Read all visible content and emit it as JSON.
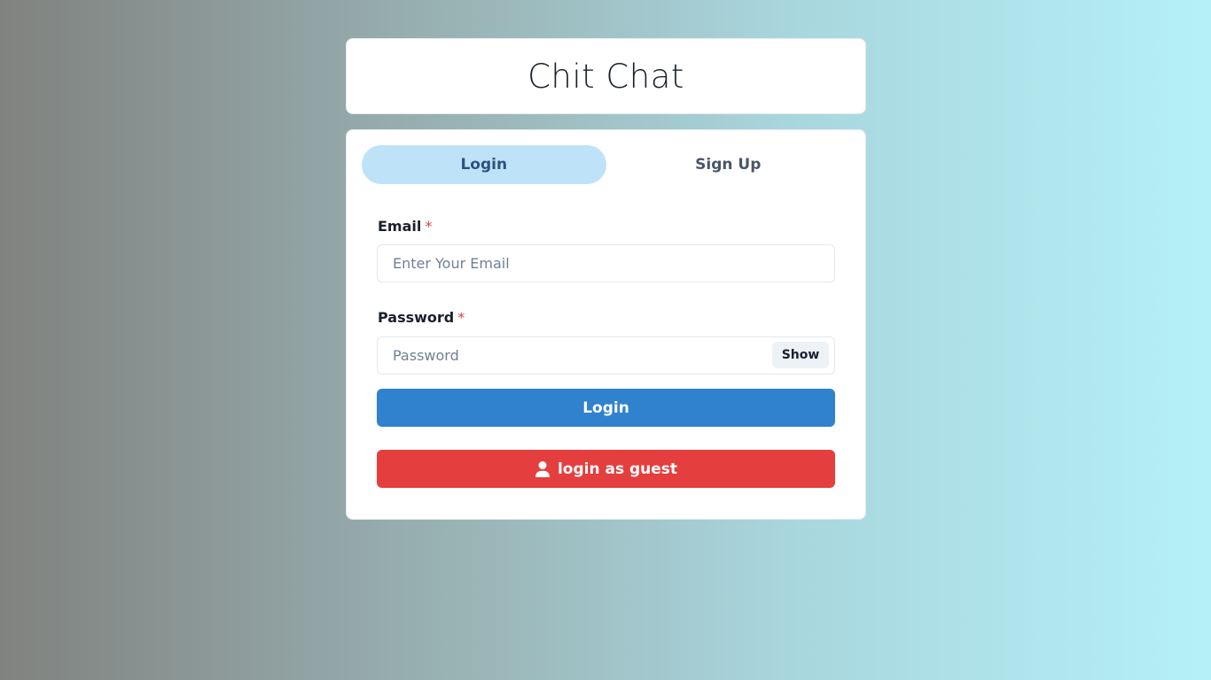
{
  "app": {
    "title": "Chit Chat"
  },
  "tabs": [
    {
      "label": "Login",
      "active": true
    },
    {
      "label": "Sign Up",
      "active": false
    }
  ],
  "form": {
    "email": {
      "label": "Email",
      "required_mark": "*",
      "value": "",
      "placeholder": "Enter Your Email"
    },
    "password": {
      "label": "Password",
      "required_mark": "*",
      "value": "",
      "placeholder": "Password",
      "toggle_label": "Show"
    },
    "submit_label": "Login",
    "guest_label": "login as guest",
    "guest_icon": "user-icon"
  },
  "colors": {
    "active_tab_bg": "#bee3f8",
    "login_button": "#3182ce",
    "guest_button": "#e53e3e",
    "required_mark": "#e53e3e"
  }
}
